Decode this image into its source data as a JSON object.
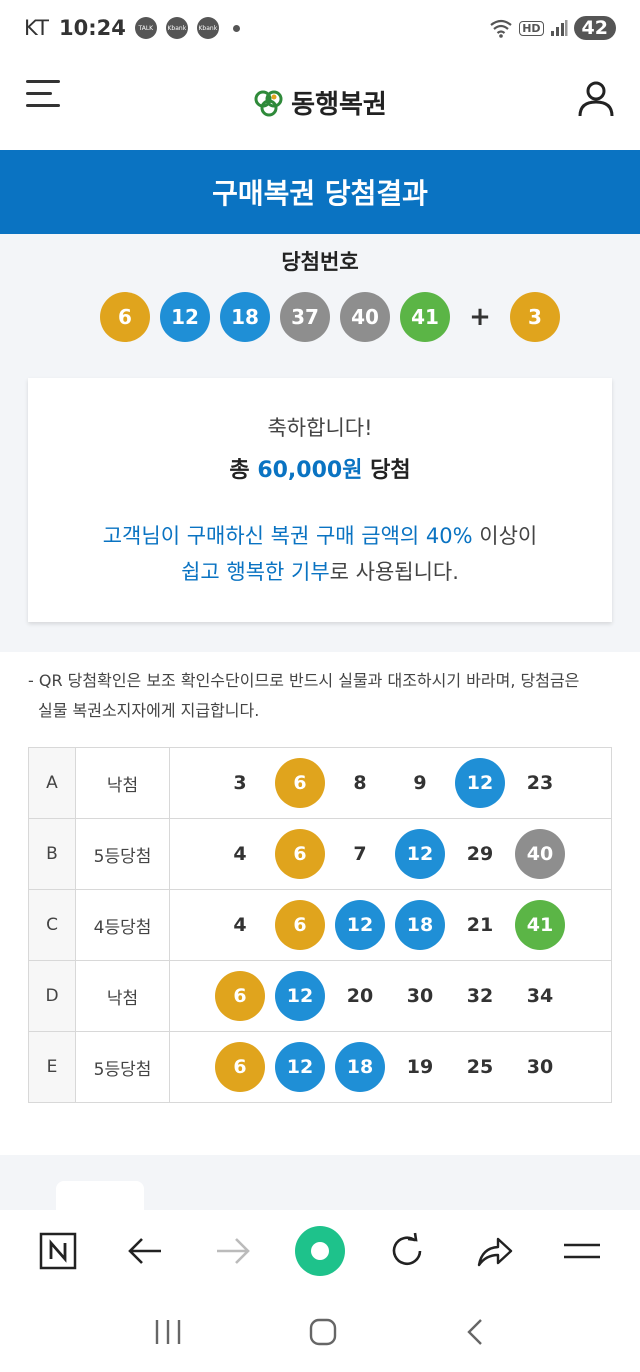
{
  "status_bar": {
    "carrier": "KT",
    "time": "10:24",
    "notifications": [
      "TALK",
      "Kbank",
      "Kbank"
    ],
    "hd_label": "HD",
    "battery": "42"
  },
  "header": {
    "logo_text": "동행복권"
  },
  "banner": {
    "title": "구매복권 당첨결과"
  },
  "winning": {
    "title": "당첨번호",
    "numbers": [
      {
        "value": "6",
        "color": "#e0a41d"
      },
      {
        "value": "12",
        "color": "#1f8fd6"
      },
      {
        "value": "18",
        "color": "#1f8fd6"
      },
      {
        "value": "37",
        "color": "#8e8e8e"
      },
      {
        "value": "40",
        "color": "#8e8e8e"
      },
      {
        "value": "41",
        "color": "#5bb546"
      }
    ],
    "plus": "+",
    "bonus": {
      "value": "3",
      "color": "#e0a41d"
    }
  },
  "result_card": {
    "congrats": "축하합니다!",
    "total_prefix": "총",
    "total_amount": "60,000원",
    "total_suffix": "당첨",
    "donation_hl1": "고객님이 구매하신 복권 구매 금액의 40%",
    "donation_rest1": "이상이",
    "donation_hl2": "쉽고 행복한 기부",
    "donation_rest2": "로 사용됩니다."
  },
  "notice": {
    "line1": "- QR 당첨확인은 보조 확인수단이므로 반드시 실물과 대조하시기 바라며, 당첨금은",
    "line2": "실물 복권소지자에게 지급합니다."
  },
  "games": [
    {
      "id": "A",
      "result": "낙첨",
      "numbers": [
        {
          "v": "3",
          "c": ""
        },
        {
          "v": "6",
          "c": "#e0a41d"
        },
        {
          "v": "8",
          "c": ""
        },
        {
          "v": "9",
          "c": ""
        },
        {
          "v": "12",
          "c": "#1f8fd6"
        },
        {
          "v": "23",
          "c": ""
        }
      ]
    },
    {
      "id": "B",
      "result": "5등당첨",
      "numbers": [
        {
          "v": "4",
          "c": ""
        },
        {
          "v": "6",
          "c": "#e0a41d"
        },
        {
          "v": "7",
          "c": ""
        },
        {
          "v": "12",
          "c": "#1f8fd6"
        },
        {
          "v": "29",
          "c": ""
        },
        {
          "v": "40",
          "c": "#8e8e8e"
        }
      ]
    },
    {
      "id": "C",
      "result": "4등당첨",
      "numbers": [
        {
          "v": "4",
          "c": ""
        },
        {
          "v": "6",
          "c": "#e0a41d"
        },
        {
          "v": "12",
          "c": "#1f8fd6"
        },
        {
          "v": "18",
          "c": "#1f8fd6"
        },
        {
          "v": "21",
          "c": ""
        },
        {
          "v": "41",
          "c": "#5bb546"
        }
      ]
    },
    {
      "id": "D",
      "result": "낙첨",
      "numbers": [
        {
          "v": "6",
          "c": "#e0a41d"
        },
        {
          "v": "12",
          "c": "#1f8fd6"
        },
        {
          "v": "20",
          "c": ""
        },
        {
          "v": "30",
          "c": ""
        },
        {
          "v": "32",
          "c": ""
        },
        {
          "v": "34",
          "c": ""
        }
      ]
    },
    {
      "id": "E",
      "result": "5등당첨",
      "numbers": [
        {
          "v": "6",
          "c": "#e0a41d"
        },
        {
          "v": "12",
          "c": "#1f8fd6"
        },
        {
          "v": "18",
          "c": "#1f8fd6"
        },
        {
          "v": "19",
          "c": ""
        },
        {
          "v": "25",
          "c": ""
        },
        {
          "v": "30",
          "c": ""
        }
      ]
    }
  ],
  "browser_bar": {
    "icons": [
      "naver-icon",
      "back-arrow-icon",
      "forward-arrow-icon",
      "home-icon",
      "refresh-icon",
      "share-icon",
      "menu-icon"
    ]
  },
  "nav_bar": {
    "icons": [
      "recents-icon",
      "home-circle-icon",
      "back-icon"
    ]
  },
  "colors": {
    "brand_blue": "#0a73c2",
    "yellow": "#e0a41d",
    "blue": "#1f8fd6",
    "gray": "#8e8e8e",
    "green": "#5bb546"
  }
}
